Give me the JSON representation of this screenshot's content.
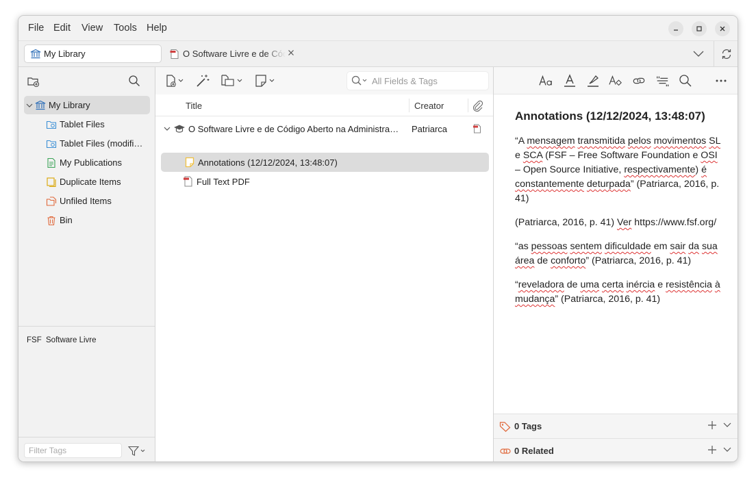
{
  "menubar": {
    "items": [
      "File",
      "Edit",
      "View",
      "Tools",
      "Help"
    ]
  },
  "tabs": {
    "library_label": "My Library",
    "doc_tab_label": "O Software Livre e de Código Aberto na Administração Pública"
  },
  "collections": {
    "root_label": "My Library",
    "items": [
      {
        "label": "Tablet Files",
        "icon": "tablet-files-icon"
      },
      {
        "label": "Tablet Files (modifi…",
        "icon": "tablet-files-icon"
      },
      {
        "label": "My Publications",
        "icon": "publications-icon"
      },
      {
        "label": "Duplicate Items",
        "icon": "duplicate-icon"
      },
      {
        "label": "Unfiled Items",
        "icon": "unfiled-icon"
      },
      {
        "label": "Bin",
        "icon": "trash-icon"
      }
    ]
  },
  "tags": {
    "items": [
      "FSF",
      "Software Livre"
    ],
    "filter_placeholder": "Filter Tags"
  },
  "items_pane": {
    "search_placeholder": "All Fields & Tags",
    "columns": {
      "title": "Title",
      "creator": "Creator"
    },
    "rows": [
      {
        "title": "O Software Livre e de Código Aberto na Administra…",
        "creator": "Patriarca"
      },
      {
        "title": "Annotations (12/12/2024, 13:48:07)",
        "creator": ""
      },
      {
        "title": "Full Text PDF",
        "creator": ""
      }
    ]
  },
  "note": {
    "title": "Annotations (12/12/2024, 13:48:07)"
  },
  "sections": {
    "tags": "0 Tags",
    "related": "0 Related"
  },
  "colors": {
    "selection": "#dcdcdc",
    "library_icon": "#2e6fb8",
    "pdf_red": "#d04040",
    "note_yellow": "#f0c040"
  }
}
